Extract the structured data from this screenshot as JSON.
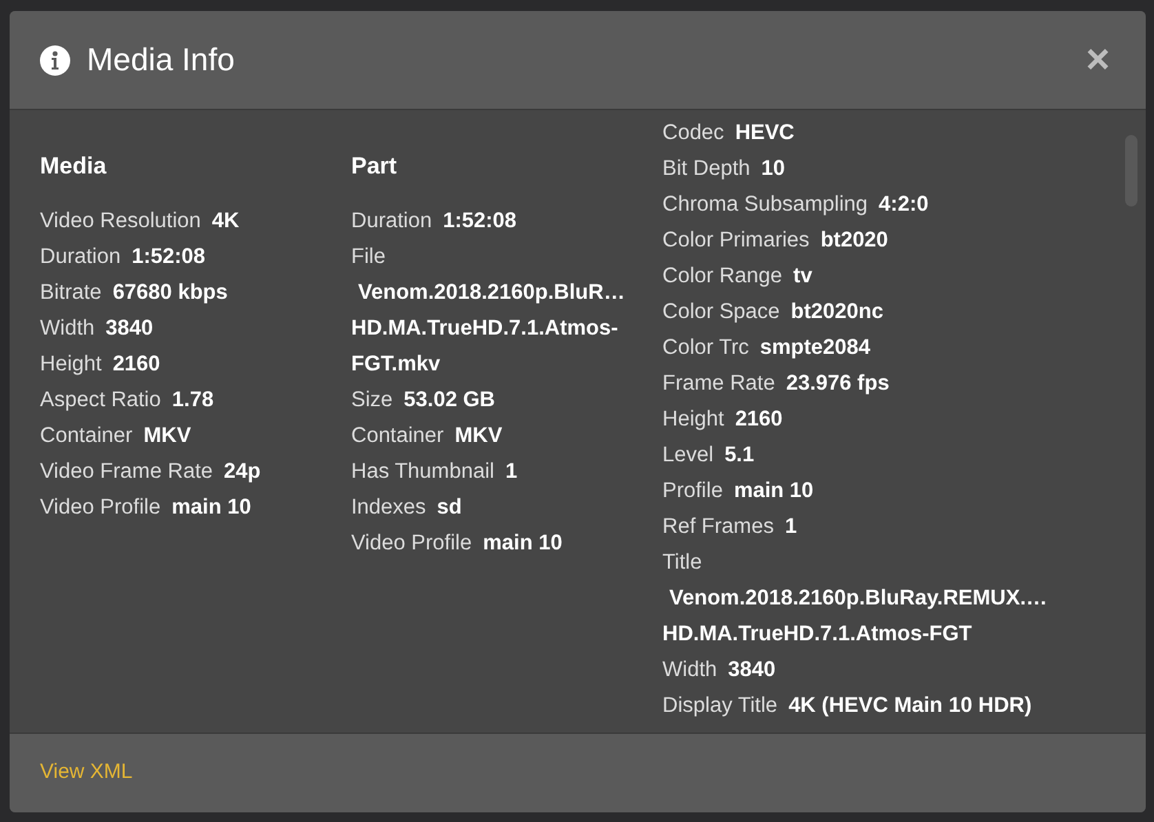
{
  "dialog": {
    "title": "Media Info",
    "close": "×"
  },
  "columns": [
    {
      "heading": "Media",
      "rows": [
        {
          "label": "Video Resolution",
          "value": "4K"
        },
        {
          "label": "Duration",
          "value": "1:52:08"
        },
        {
          "label": "Bitrate",
          "value": "67680 kbps"
        },
        {
          "label": "Width",
          "value": "3840"
        },
        {
          "label": "Height",
          "value": "2160"
        },
        {
          "label": "Aspect Ratio",
          "value": "1.78"
        },
        {
          "label": "Container",
          "value": "MKV"
        },
        {
          "label": "Video Frame Rate",
          "value": "24p"
        },
        {
          "label": "Video Profile",
          "value": "main 10"
        }
      ]
    },
    {
      "heading": "Part",
      "rows": [
        {
          "label": "Duration",
          "value": "1:52:08"
        },
        {
          "label": "File",
          "value_lines": [
            "Venom.2018.2160p.BluR…",
            "HD.MA.TrueHD.7.1.Atmos-",
            "FGT.mkv"
          ]
        },
        {
          "label": "Size",
          "value": "53.02 GB"
        },
        {
          "label": "Container",
          "value": "MKV"
        },
        {
          "label": "Has Thumbnail",
          "value": "1"
        },
        {
          "label": "Indexes",
          "value": "sd"
        },
        {
          "label": "Video Profile",
          "value": "main 10"
        }
      ]
    },
    {
      "rows": [
        {
          "label": "Codec",
          "value": "HEVC"
        },
        {
          "label": "Bit Depth",
          "value": "10"
        },
        {
          "label": "Chroma Subsampling",
          "value": "4:2:0"
        },
        {
          "label": "Color Primaries",
          "value": "bt2020"
        },
        {
          "label": "Color Range",
          "value": "tv"
        },
        {
          "label": "Color Space",
          "value": "bt2020nc"
        },
        {
          "label": "Color Trc",
          "value": "smpte2084"
        },
        {
          "label": "Frame Rate",
          "value": "23.976 fps"
        },
        {
          "label": "Height",
          "value": "2160"
        },
        {
          "label": "Level",
          "value": "5.1"
        },
        {
          "label": "Profile",
          "value": "main 10"
        },
        {
          "label": "Ref Frames",
          "value": "1"
        },
        {
          "label": "Title",
          "value_lines": [
            "Venom.2018.2160p.BluRay.REMUX.…",
            "HD.MA.TrueHD.7.1.Atmos-FGT"
          ]
        },
        {
          "label": "Width",
          "value": "3840"
        },
        {
          "label": "Display Title",
          "value": "4K (HEVC Main 10 HDR)"
        }
      ]
    }
  ],
  "footer": {
    "link": "View XML"
  }
}
